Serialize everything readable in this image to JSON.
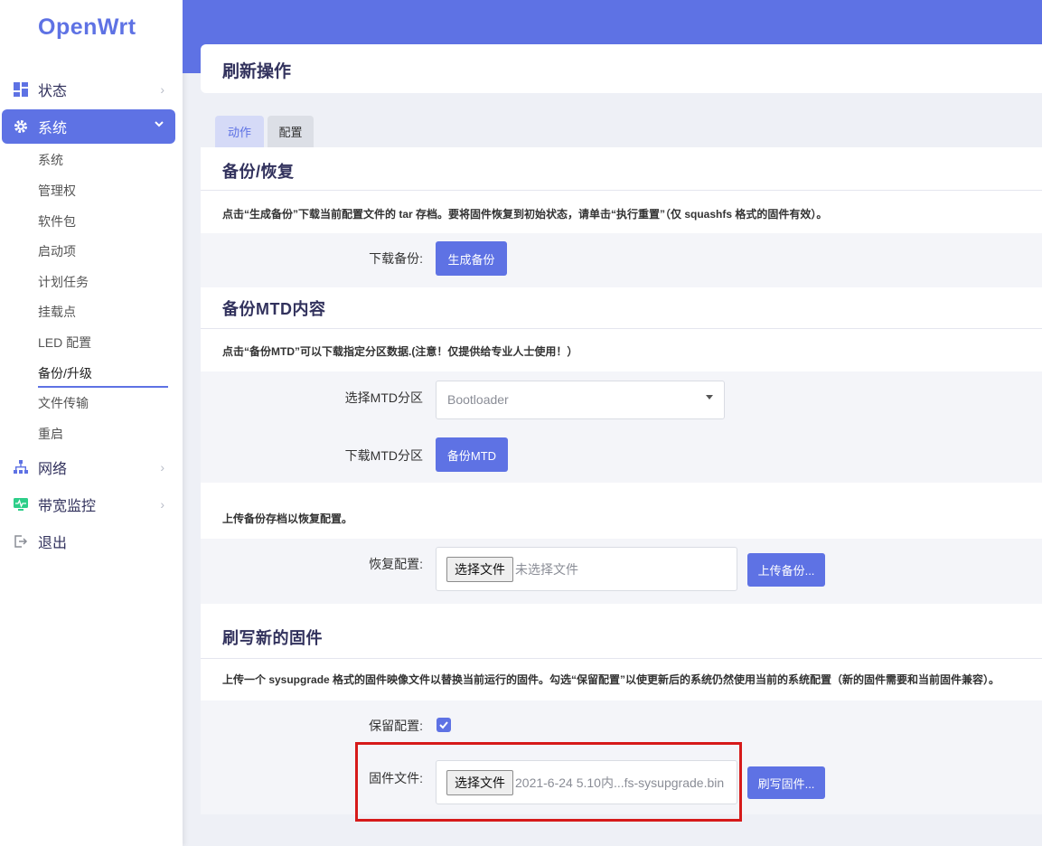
{
  "app": {
    "logo": "OpenWrt"
  },
  "sidebar": {
    "items": [
      {
        "label": "状态",
        "icon": "dashboard-icon"
      },
      {
        "label": "系统",
        "icon": "gear-icon"
      },
      {
        "label": "网络",
        "icon": "network-icon"
      },
      {
        "label": "带宽监控",
        "icon": "monitor-icon"
      },
      {
        "label": "退出",
        "icon": "logout-icon"
      }
    ],
    "sub_items": [
      "系统",
      "管理权",
      "软件包",
      "启动项",
      "计划任务",
      "挂载点",
      "LED 配置",
      "备份/升级",
      "文件传输",
      "重启"
    ]
  },
  "page": {
    "title": "刷新操作"
  },
  "tabs": {
    "action": "动作",
    "config": "配置"
  },
  "backup": {
    "title": "备份/恢复",
    "desc": "点击“生成备份”下载当前配置文件的 tar 存档。要将固件恢复到初始状态，请单击“执行重置”（仅 squashfs 格式的固件有效）。",
    "download_label": "下载备份:",
    "generate_button": "生成备份"
  },
  "mtd": {
    "title": "备份MTD内容",
    "desc": "点击“备份MTD”可以下载指定分区数据.(注意！仅提供给专业人士使用！）",
    "select_label": "选择MTD分区",
    "select_value": "Bootloader",
    "download_label": "下载MTD分区",
    "backup_button": "备份MTD"
  },
  "restore": {
    "desc": "上传备份存档以恢复配置。",
    "label": "恢复配置:",
    "choose_button": "选择文件",
    "file_name": "未选择文件",
    "upload_button": "上传备份..."
  },
  "flash": {
    "title": "刷写新的固件",
    "desc": "上传一个 sysupgrade 格式的固件映像文件以替换当前运行的固件。勾选“保留配置”以使更新后的系统仍然使用当前的系统配置（新的固件需要和当前固件兼容）。",
    "keep_label": "保留配置:",
    "keep_checked": true,
    "file_label": "固件文件:",
    "choose_button": "选择文件",
    "file_name": "2021-6-24 5.10内...fs-sysupgrade.bin",
    "flash_button": "刷写固件..."
  },
  "colors": {
    "accent": "#5e72e4",
    "highlight": "#d61a1a"
  }
}
